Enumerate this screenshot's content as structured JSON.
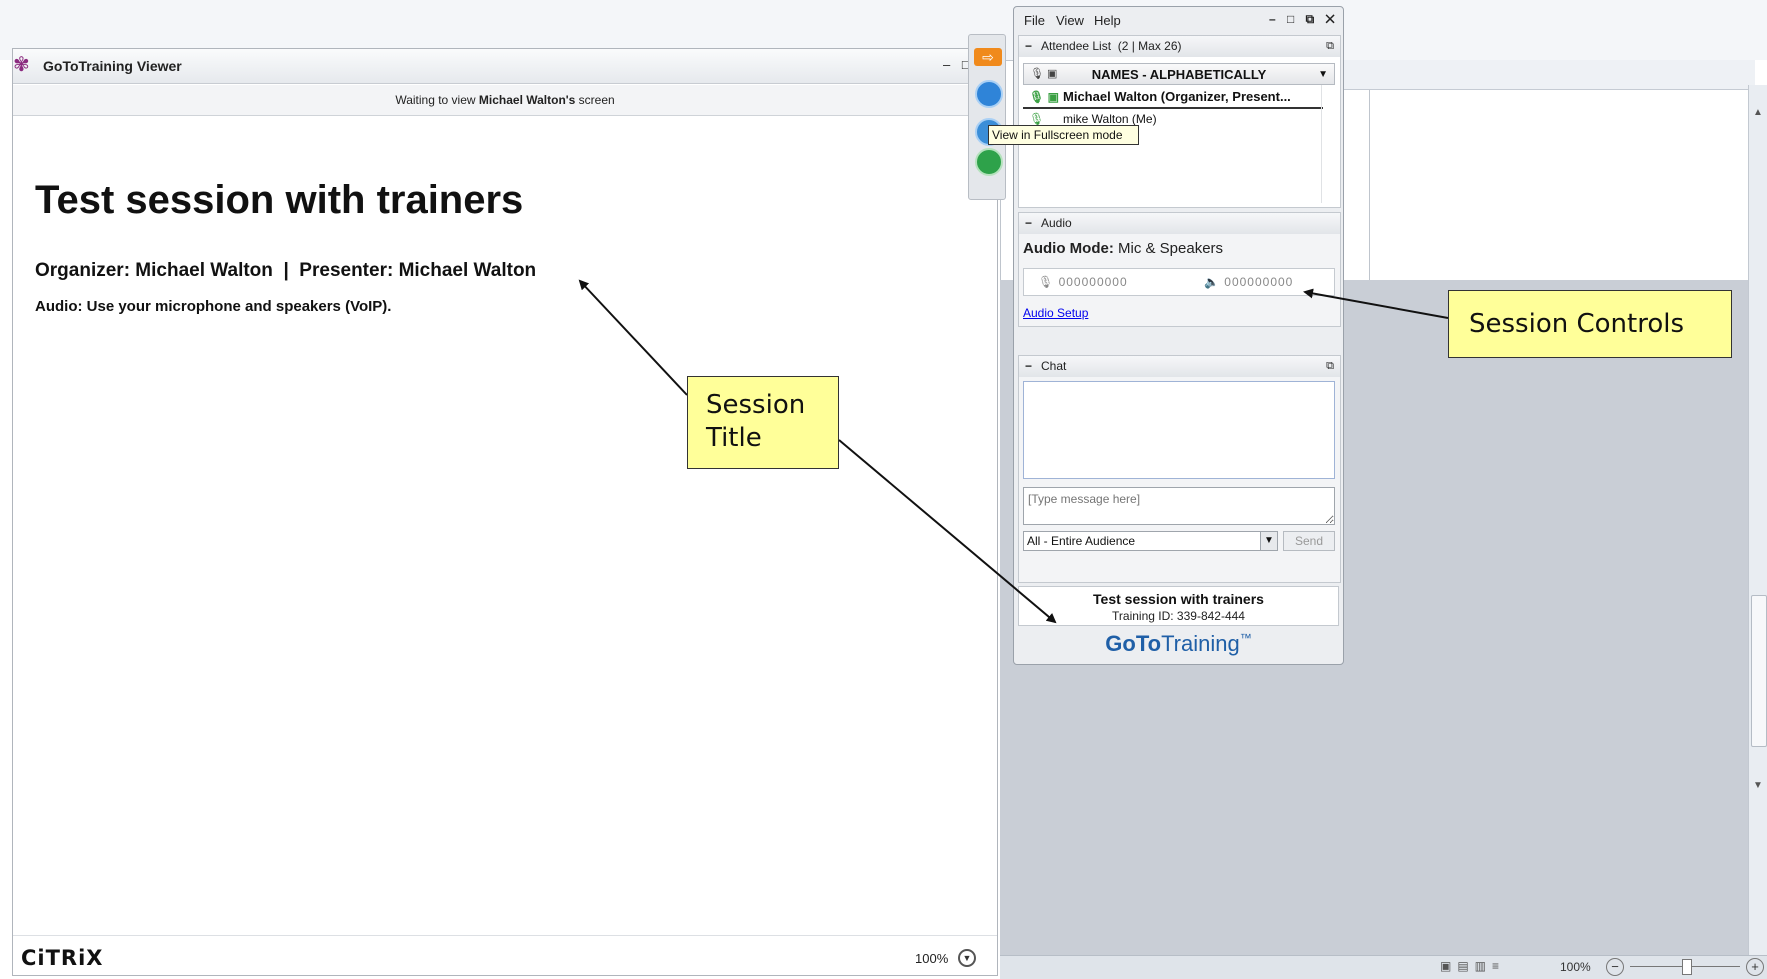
{
  "viewer": {
    "title": "GoToTraining Viewer",
    "waiting_prefix": "Waiting to view ",
    "waiting_name": "Michael Walton's",
    "waiting_suffix": " screen",
    "session_heading": "Test session with trainers",
    "organizer_line": "Organizer: Michael Walton  |  Presenter: Michael Walton",
    "audio_line": "Audio: Use your microphone and speakers (VoIP).",
    "footer_logo": "CiTRiX",
    "zoom": "100%"
  },
  "tooltip": "View in Fullscreen mode",
  "panel": {
    "menu": [
      "File",
      "View",
      "Help"
    ],
    "attendee_header": "Attendee List  (2 | Max 26)",
    "names_sort": "NAMES - ALPHABETICALLY",
    "attendees": [
      "Michael Walton (Organizer, Present...",
      "mike Walton (Me)"
    ],
    "audio_header": "Audio",
    "audio_mode_label": "Audio Mode:",
    "audio_mode_value": "Mic & Speakers",
    "mic_level": "000000000",
    "speaker_level": "000000000",
    "audio_setup": "Audio Setup",
    "chat_header": "Chat",
    "chat_placeholder": "[Type message here]",
    "audience": "All - Entire Audience",
    "send": "Send",
    "session_title": "Test session with trainers",
    "training_id": "Training ID: 339-842-444",
    "brand_goto": "GoTo",
    "brand_training": "Training",
    "brand_tm": "™"
  },
  "status_bar": {
    "zoom": "100%"
  },
  "callouts": {
    "session_title_line1": "Session",
    "session_title_line2": "Title",
    "session_controls": "Session Controls"
  },
  "colors": {
    "callout_fill": "#ffff99",
    "link": "#0000ee",
    "brand_blue": "#1f5fa7",
    "mic_green": "#3aa043"
  }
}
